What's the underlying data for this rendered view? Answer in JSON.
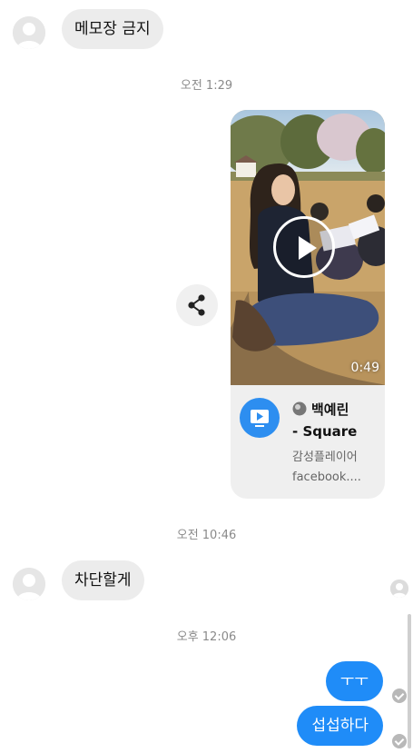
{
  "messages": {
    "m1": "메모장 금지",
    "t1": "오전 1:29",
    "t2": "오전 10:46",
    "m2": "차단할게",
    "t3": "오후 12:06",
    "o1": "ㅜㅜ",
    "o2": "섭섭하다"
  },
  "shared_card": {
    "duration": "0:49",
    "title_line1": "백예린",
    "title_line2": "- Square",
    "app_name": "감성플레이어",
    "domain": "facebook...."
  },
  "icons": {
    "avatar": "person-icon",
    "share": "share-icon",
    "play": "play-icon",
    "app": "video-play-icon",
    "globe": "globe-icon",
    "read": "check-icon"
  },
  "colors": {
    "incoming_bubble": "#ececec",
    "outgoing_bubble": "#1f8cf8",
    "app_icon": "#2d8ef0"
  }
}
